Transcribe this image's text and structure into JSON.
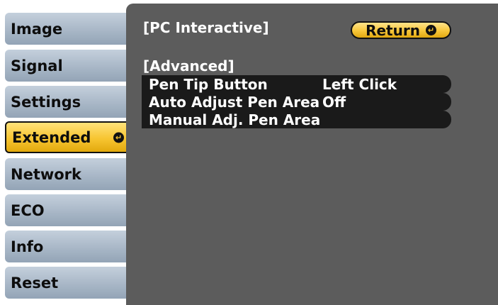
{
  "sidebar": {
    "items": [
      {
        "label": "Image"
      },
      {
        "label": "Signal"
      },
      {
        "label": "Settings"
      },
      {
        "label": "Extended",
        "active": true
      },
      {
        "label": "Network"
      },
      {
        "label": "ECO"
      },
      {
        "label": "Info"
      },
      {
        "label": "Reset"
      }
    ],
    "enter_glyph": "↵"
  },
  "header": {
    "breadcrumb": "[PC Interactive]",
    "return_label": "Return",
    "return_icon": "enter-icon"
  },
  "main": {
    "section_title": "[Advanced]",
    "settings": [
      {
        "label": "Pen Tip Button",
        "value": "Left Click"
      },
      {
        "label": "Auto Adjust Pen Area",
        "value": "Off"
      },
      {
        "label": "Manual Adj. Pen Area",
        "value": ""
      }
    ]
  },
  "colors": {
    "panel_background": "#5c5c5c",
    "highlight_yellow": "#f7c531",
    "tab_blue_gray": "#a6b5c5",
    "row_black": "#1a1a1a"
  }
}
